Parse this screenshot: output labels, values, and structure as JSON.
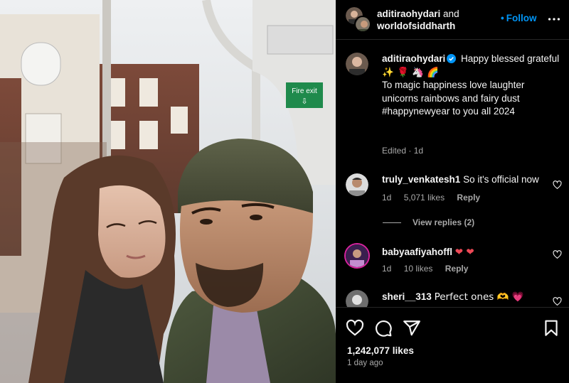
{
  "post": {
    "author_1": "aditiraohydari",
    "and_text": "and",
    "author_2": "worldofsiddharth",
    "follow_dot": "•",
    "follow_label": "Follow",
    "more_icon": "more-horizontal-icon"
  },
  "caption": {
    "username": "aditiraohydari",
    "line1": "Happy blessed grateful",
    "emoji_line": "✨ 🌹 🦄 🌈",
    "body": "To magic happiness love laughter unicorns rainbows and fairy dust #happynewyear to you all 2024",
    "meta": "Edited · 1d"
  },
  "comments": [
    {
      "username": "truly_venkatesh1",
      "text": "So it's official now",
      "time": "1d",
      "likes": "5,071 likes",
      "reply": "Reply"
    },
    {
      "username": "babyaafiyahoffl",
      "text": "❤ ❤",
      "time": "1d",
      "likes": "10 likes",
      "reply": "Reply"
    },
    {
      "username": "sheri__313",
      "text": "Perfect ones 🫶 💗",
      "time": "",
      "likes": "",
      "reply": ""
    }
  ],
  "view_replies": "View replies (2)",
  "photo_sign": "Fire exit",
  "photo_sign_arrow": "⇩",
  "actions": {
    "like_icon": "heart-icon",
    "comment_icon": "comment-icon",
    "share_icon": "share-icon",
    "save_icon": "bookmark-icon",
    "likes": "1,242,077 likes",
    "time": "1 day ago"
  },
  "colors": {
    "accent": "#0095f6",
    "verified": "#0095f6",
    "heart": "#ed4956",
    "muted": "#a8a8a8"
  }
}
